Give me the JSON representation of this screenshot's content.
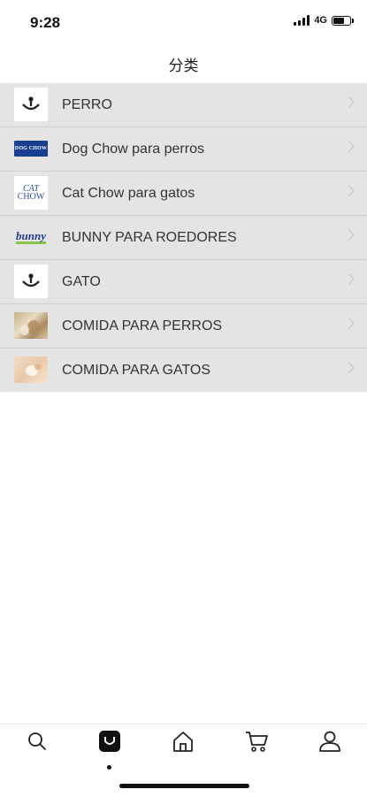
{
  "status_bar": {
    "time": "9:28",
    "network": "4G",
    "battery_level": 0.7
  },
  "header": {
    "title": "分类"
  },
  "categories": [
    {
      "label": "PERRO",
      "icon": "purina-face-logo"
    },
    {
      "label": "Dog Chow para perros",
      "icon": "dog-chow-logo",
      "logo_text": "DOG CHOW"
    },
    {
      "label": "Cat Chow para gatos",
      "icon": "cat-chow-logo",
      "logo_text_1": "CAT",
      "logo_text_2": "CHOW"
    },
    {
      "label": "BUNNY PARA ROEDORES",
      "icon": "bunny-logo",
      "logo_text": "bunny"
    },
    {
      "label": "GATO",
      "icon": "purina-face-logo"
    },
    {
      "label": "COMIDA PARA PERROS",
      "icon": "dog-food-photo"
    },
    {
      "label": "COMIDA PARA GATOS",
      "icon": "cat-food-photo"
    }
  ],
  "tab_bar": {
    "tabs": [
      {
        "name": "search",
        "icon": "search-icon",
        "active": false
      },
      {
        "name": "categories",
        "icon": "bag-icon",
        "active": true
      },
      {
        "name": "home",
        "icon": "home-icon",
        "active": false
      },
      {
        "name": "cart",
        "icon": "cart-icon",
        "active": false
      },
      {
        "name": "profile",
        "icon": "user-icon",
        "active": false
      }
    ]
  },
  "colors": {
    "list_background": "#e4e4e4",
    "divider": "#cfcfcf",
    "dog_chow_blue": "#1b3f8f",
    "bunny_blue": "#1e3e94",
    "bunny_green": "#8bc34a"
  }
}
